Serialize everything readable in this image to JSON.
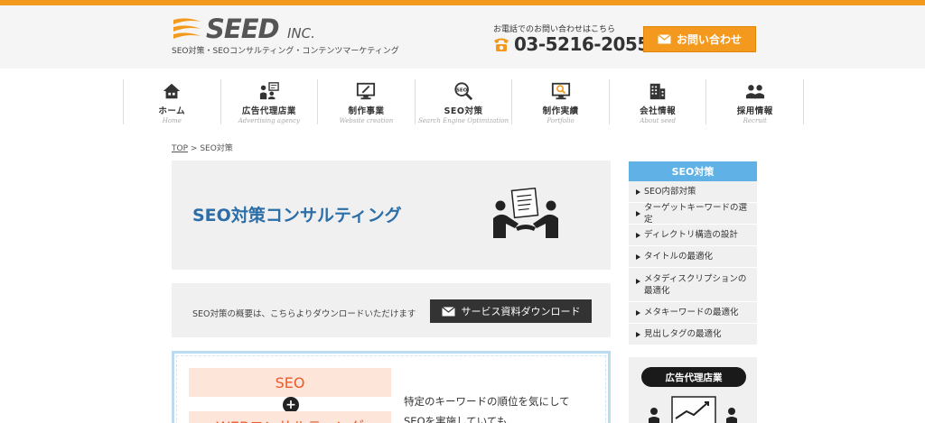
{
  "colors": {
    "accent_orange": "#f39a1e",
    "link_blue": "#2b6ea8",
    "sidebar_blue": "#5fb1e6",
    "seo_orange": "#e95a2a"
  },
  "header": {
    "logo_word": "SEED",
    "logo_suffix": "INC.",
    "tagline": "SEO対策・SEOコンサルティング・コンテンツマーケティング",
    "phone_label": "お電話でのお問い合わせはこちら",
    "phone_number": "03-5216-2055",
    "phone_icon": "telephone-icon",
    "contact_button": "お問い合わせ"
  },
  "nav": {
    "items": [
      {
        "label": "ホーム",
        "sub": "Home",
        "icon": "house-icon"
      },
      {
        "label": "広告代理店業",
        "sub": "Advertising agency",
        "icon": "people-board-icon"
      },
      {
        "label": "制作事業",
        "sub": "Website creation",
        "icon": "monitor-pen-icon"
      },
      {
        "label": "SEO対策",
        "sub": "Search Engine Optimization",
        "icon": "magnifier-seo-icon"
      },
      {
        "label": "制作実績",
        "sub": "Portfolio",
        "icon": "monitor-search-icon"
      },
      {
        "label": "会社情報",
        "sub": "About seed",
        "icon": "building-icon"
      },
      {
        "label": "採用情報",
        "sub": "Recruit",
        "icon": "people-icon"
      }
    ]
  },
  "breadcrumb": {
    "home": "TOP",
    "separator": ">",
    "current": "SEO対策"
  },
  "hero": {
    "title": "SEO対策コンサルティング",
    "illustration": "handshake-document-icon"
  },
  "download": {
    "text": "SEO対策の概要は、こちらよりダウンロードいただけます",
    "button": "サービス資料ダウンロード"
  },
  "lower": {
    "pill_seo": "SEO",
    "plus": "+",
    "pill_web": "WEBコンサルティング",
    "text_line1": "特定のキーワードの順位を気にして",
    "text_line2": "SEOを実施していても、"
  },
  "sidebar": {
    "heading": "SEO対策",
    "items": [
      "SEO内部対策",
      "ターゲットキーワードの選定",
      "ディレクトリ構造の設計",
      "タイトルの最適化",
      "メタディスクリプションの最適化",
      "メタキーワードの最適化",
      "見出しタグの最適化"
    ],
    "agency_heading": "広告代理店業",
    "agency_illustration": "presentation-chart-icon"
  }
}
